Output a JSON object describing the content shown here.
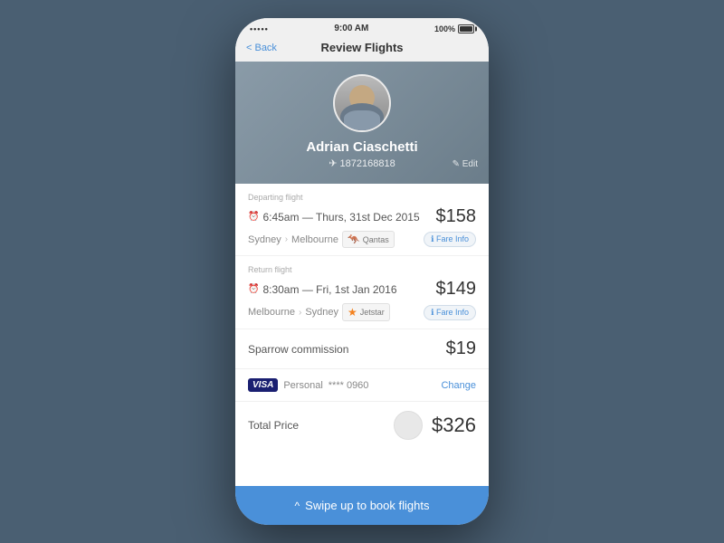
{
  "statusBar": {
    "dots": "•••••",
    "wifi": "wifi",
    "time": "9:00 AM",
    "battery": "100%"
  },
  "navBar": {
    "backLabel": "< Back",
    "title": "Review Flights"
  },
  "profile": {
    "name": "Adrian Ciaschetti",
    "phone": "✈ 1872168818",
    "editLabel": "✎ Edit"
  },
  "departingFlight": {
    "sectionLabel": "Departing flight",
    "time": "6:45am — Thurs, 31st Dec 2015",
    "price": "$158",
    "from": "Sydney",
    "to": "Melbourne",
    "airline": "Qantas",
    "fareInfoLabel": "ℹ Fare Info"
  },
  "returnFlight": {
    "sectionLabel": "Return flight",
    "time": "8:30am — Fri, 1st Jan 2016",
    "price": "$149",
    "from": "Melbourne",
    "to": "Sydney",
    "airline": "Jetstar",
    "fareInfoLabel": "ℹ Fare Info"
  },
  "commission": {
    "label": "Sparrow commission",
    "price": "$19"
  },
  "payment": {
    "visa": "VISA",
    "type": "Personal",
    "card": "**** 0960",
    "changeLabel": "Change"
  },
  "total": {
    "label": "Total Price",
    "price": "$326"
  },
  "bottomButton": {
    "chevron": "^",
    "label": "Swipe up to book flights"
  }
}
